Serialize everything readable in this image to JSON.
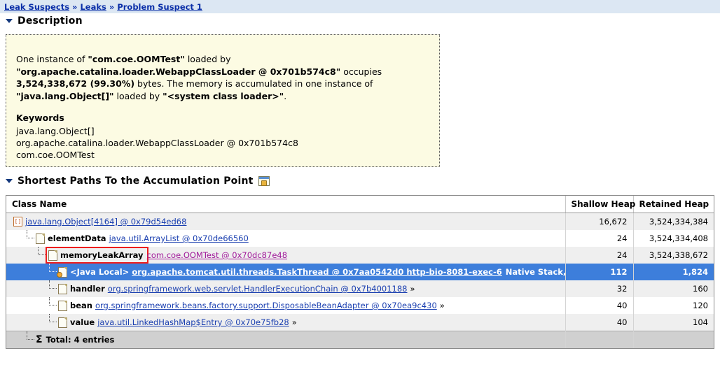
{
  "breadcrumb": {
    "separator": "»",
    "items": [
      {
        "label": "Leak Suspects"
      },
      {
        "label": "Leaks"
      },
      {
        "label": "Problem Suspect 1"
      }
    ]
  },
  "description_section": {
    "title": "Description",
    "toggle_icon": "triangle-down-icon",
    "body": {
      "paragraph_parts": [
        {
          "text": "One instance of ",
          "bold": false
        },
        {
          "text": "\"com.coe.OOMTest\"",
          "bold": true
        },
        {
          "text": " loaded by ",
          "bold": false
        },
        {
          "text": "\"org.apache.catalina.loader.WebappClassLoader @ 0x701b574c8\"",
          "bold": true
        },
        {
          "text": " occupies ",
          "bold": false
        },
        {
          "text": "3,524,338,672 (99.30%)",
          "bold": true
        },
        {
          "text": " bytes. The memory is accumulated in one instance of ",
          "bold": false
        },
        {
          "text": "\"java.lang.Object[]\"",
          "bold": true
        },
        {
          "text": " loaded by ",
          "bold": false
        },
        {
          "text": "\"<system class loader>\"",
          "bold": true
        },
        {
          "text": ".",
          "bold": false
        }
      ],
      "keywords_title": "Keywords",
      "keywords": [
        "java.lang.Object[]",
        "org.apache.catalina.loader.WebappClassLoader @ 0x701b574c8",
        "com.coe.OOMTest"
      ]
    }
  },
  "paths_section": {
    "title": "Shortest Paths To the Accumulation Point",
    "toggle_icon": "triangle-down-icon",
    "view_icon": "open-view-icon",
    "table": {
      "columns": [
        {
          "key": "class_name",
          "label": "Class Name",
          "align": "left"
        },
        {
          "key": "shallow_heap",
          "label": "Shallow Heap",
          "align": "right"
        },
        {
          "key": "retained_heap",
          "label": "Retained Heap",
          "align": "right"
        }
      ],
      "rows": [
        {
          "depth": 0,
          "icon": "array-icon",
          "field": "",
          "class_link": "java.lang.Object[4164] @ 0x79d54ed68",
          "link_color": "blue",
          "suffix": "",
          "trailing": "",
          "shallow_heap": "16,672",
          "retained_heap": "3,524,334,384",
          "selected": false,
          "highlighted": false,
          "striped": true
        },
        {
          "depth": 1,
          "icon": "object-icon",
          "field": "elementData",
          "class_link": "java.util.ArrayList @ 0x70de66560",
          "link_color": "blue",
          "suffix": "",
          "trailing": "",
          "shallow_heap": "24",
          "retained_heap": "3,524,334,408",
          "selected": false,
          "highlighted": false,
          "striped": false
        },
        {
          "depth": 2,
          "icon": "object-icon",
          "field": "memoryLeakArray",
          "class_link": "com.coe.OOMTest @ 0x70dc87e48",
          "link_color": "magenta",
          "suffix": "",
          "trailing": "",
          "shallow_heap": "24",
          "retained_heap": "3,524,338,672",
          "selected": false,
          "highlighted": true,
          "striped": true
        },
        {
          "depth": 3,
          "icon": "thread-object-icon",
          "field": "<Java Local>",
          "class_link": "org.apache.tomcat.util.threads.TaskThread @ 0x7aa0542d0 http-bio-8081-exec-6",
          "link_color": "blue",
          "suffix": "",
          "trailing": "Native Stack, Thread",
          "shallow_heap": "112",
          "retained_heap": "1,824",
          "selected": true,
          "highlighted": false,
          "striped": false
        },
        {
          "depth": 3,
          "icon": "object-icon",
          "field": "handler",
          "class_link": "org.springframework.web.servlet.HandlerExecutionChain @ 0x7b4001188",
          "link_color": "blue",
          "suffix": "»",
          "trailing": "",
          "shallow_heap": "32",
          "retained_heap": "160",
          "selected": false,
          "highlighted": false,
          "striped": true
        },
        {
          "depth": 3,
          "icon": "object-icon",
          "field": "bean",
          "class_link": "org.springframework.beans.factory.support.DisposableBeanAdapter @ 0x70ea9c430",
          "link_color": "blue",
          "suffix": "»",
          "trailing": "",
          "shallow_heap": "40",
          "retained_heap": "120",
          "selected": false,
          "highlighted": false,
          "striped": false
        },
        {
          "depth": 3,
          "icon": "object-icon",
          "field": "value",
          "class_link": "java.util.LinkedHashMap$Entry @ 0x70e75fb28",
          "link_color": "blue",
          "suffix": "»",
          "trailing": "",
          "shallow_heap": "40",
          "retained_heap": "104",
          "selected": false,
          "highlighted": false,
          "striped": true
        }
      ],
      "total_row": {
        "icon": "sigma-icon",
        "label": "Total: 4 entries",
        "shallow_heap": "",
        "retained_heap": ""
      }
    }
  },
  "colors": {
    "breadcrumb_bg": "#dce7f3",
    "link": "#0b2fa8",
    "description_bg": "#fcfbe3",
    "selection_bg": "#3d7edb",
    "highlight_outline": "#ee1c1c",
    "stripe_bg": "#efefef",
    "total_bg": "#d0d0d0",
    "magenta_link": "#a0189a"
  }
}
